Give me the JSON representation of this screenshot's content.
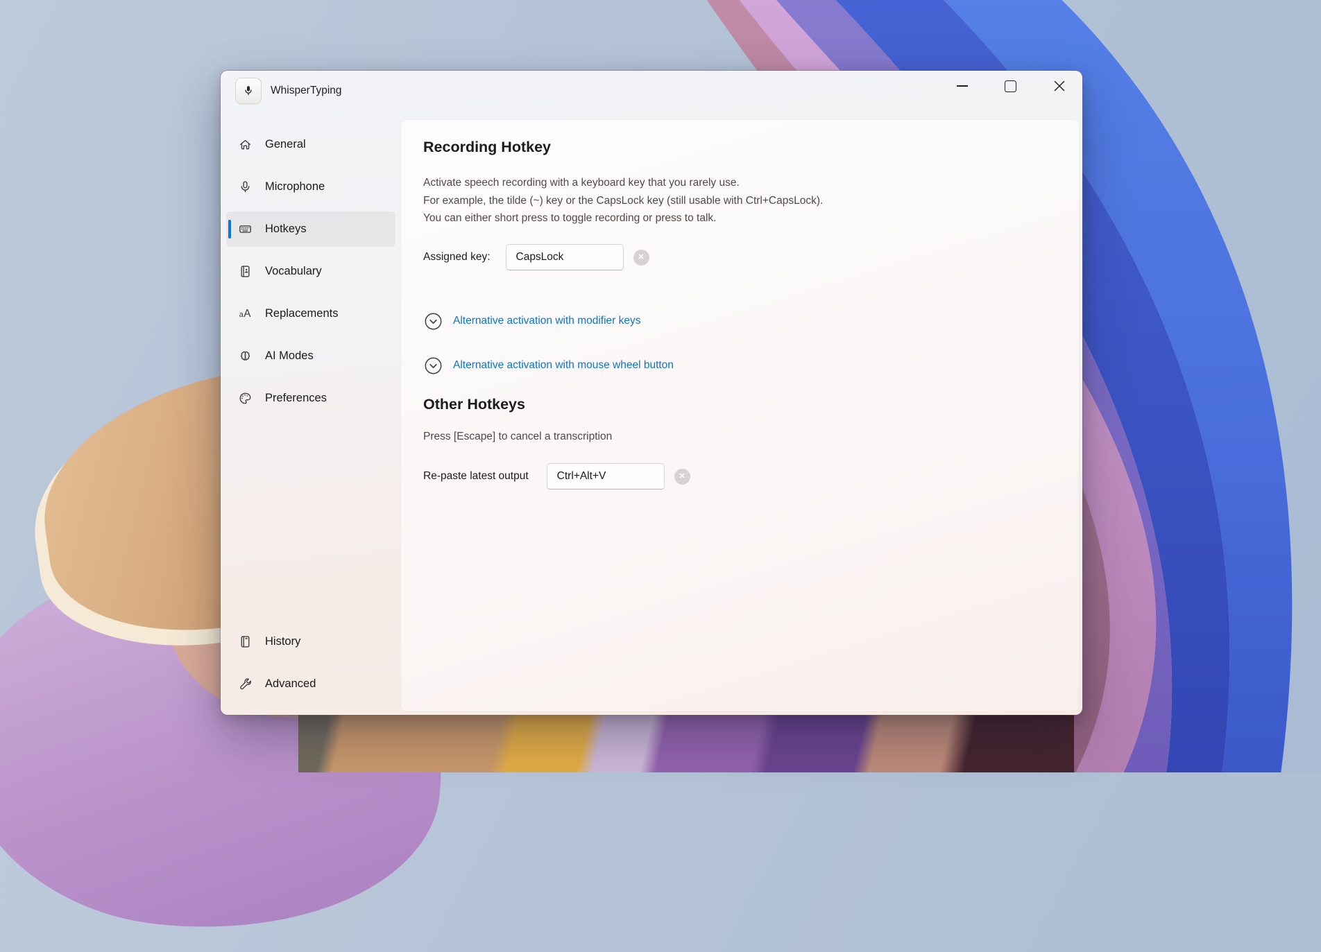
{
  "window": {
    "app_title": "WhisperTyping",
    "app_icon": "microphone-icon",
    "controls": [
      "minimize",
      "maximize",
      "close"
    ]
  },
  "sidebar": {
    "items": [
      {
        "label": "General",
        "icon": "home-icon",
        "selected": false
      },
      {
        "label": "Microphone",
        "icon": "microphone-icon",
        "selected": false
      },
      {
        "label": "Hotkeys",
        "icon": "keyboard-icon",
        "selected": true
      },
      {
        "label": "Vocabulary",
        "icon": "journal-icon",
        "selected": false
      },
      {
        "label": "Replacements",
        "icon": "text-case-icon",
        "selected": false
      },
      {
        "label": "AI Modes",
        "icon": "brain-icon",
        "selected": false
      },
      {
        "label": "Preferences",
        "icon": "palette-icon",
        "selected": false
      }
    ],
    "footer_items": [
      {
        "label": "History",
        "icon": "notebook-icon"
      },
      {
        "label": "Advanced",
        "icon": "wrench-icon"
      }
    ]
  },
  "content": {
    "recording_hotkey": {
      "heading": "Recording Hotkey",
      "description_line1": "Activate speech recording with a keyboard key that you rarely use.",
      "description_line2": "For example, the tilde (~) key or the CapsLock key (still usable with Ctrl+CapsLock).",
      "description_line3": "You can either short press to toggle recording or press to talk.",
      "assigned_key": {
        "label": "Assigned key:",
        "value": "CapsLock"
      },
      "expander1": {
        "label": "Alternative activation with modifier keys",
        "icon": "chevron-down-circle-icon"
      },
      "expander2": {
        "label": "Alternative activation with mouse wheel button",
        "icon": "chevron-down-circle-icon"
      }
    },
    "other_hotkeys": {
      "heading": "Other Hotkeys",
      "escape_hint": "Press [Escape] to cancel a transcription",
      "repaste": {
        "label": "Re-paste latest output",
        "value": "Ctrl+Alt+V"
      }
    }
  },
  "glyphs": {
    "clear": "✕"
  },
  "colors": {
    "selection_accent": "#0b79d0",
    "link": "#0d74c4",
    "clear_button_bg": "#d6d3d1"
  }
}
